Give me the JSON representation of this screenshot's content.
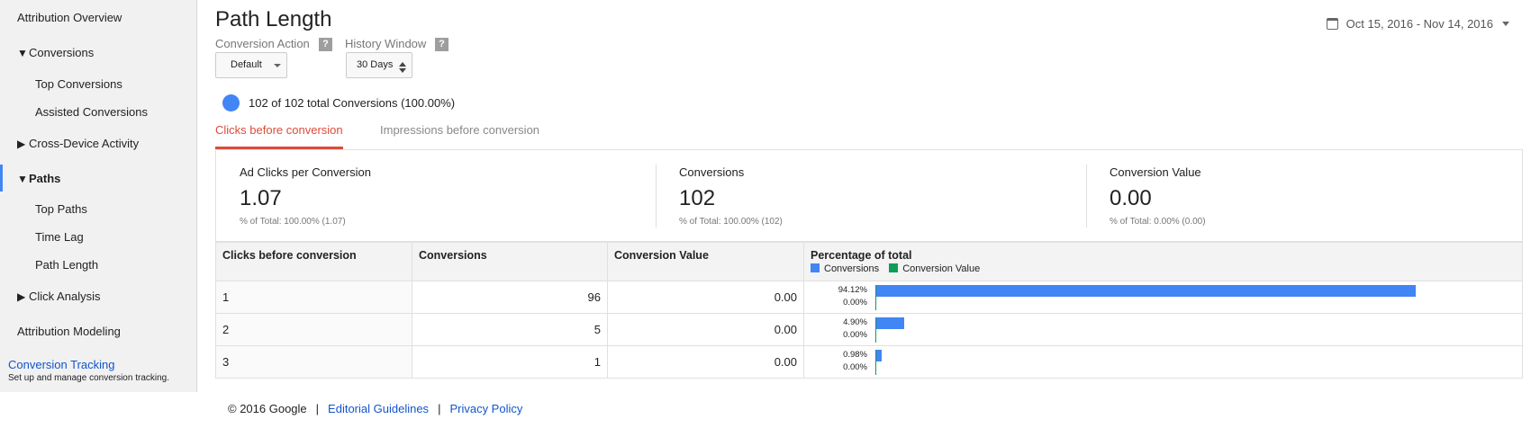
{
  "sidebar": {
    "items": [
      {
        "label": "Attribution Overview"
      },
      {
        "label": "Conversions",
        "expander": "▼"
      },
      {
        "label": "Top Conversions"
      },
      {
        "label": "Assisted Conversions"
      },
      {
        "label": "Cross-Device Activity",
        "expander": "▶"
      },
      {
        "label": "Paths",
        "expander": "▼"
      },
      {
        "label": "Top Paths"
      },
      {
        "label": "Time Lag"
      },
      {
        "label": "Path Length"
      },
      {
        "label": "Click Analysis",
        "expander": "▶"
      },
      {
        "label": "Attribution Modeling"
      }
    ],
    "footer_link": "Conversion Tracking",
    "footer_desc": "Set up and manage conversion tracking."
  },
  "header": {
    "title": "Path Length",
    "conversion_action_label": "Conversion Action",
    "conversion_action_value": "Default",
    "history_window_label": "History Window",
    "history_window_value": "30 Days",
    "help_glyph": "?",
    "date_range": "Oct 15, 2016 - Nov 14, 2016"
  },
  "summary": {
    "text": "102 of 102 total Conversions (100.00%)",
    "dot_color": "#4285f4"
  },
  "tabs": [
    {
      "label": "Clicks before conversion",
      "active": true
    },
    {
      "label": "Impressions before conversion",
      "active": false
    }
  ],
  "scorecards": [
    {
      "title": "Ad Clicks per Conversion",
      "value": "1.07",
      "sub": "% of Total: 100.00% (1.07)"
    },
    {
      "title": "Conversions",
      "value": "102",
      "sub": "% of Total: 100.00% (102)"
    },
    {
      "title": "Conversion Value",
      "value": "0.00",
      "sub": "% of Total: 0.00% (0.00)"
    }
  ],
  "table": {
    "headers": [
      "Clicks before conversion",
      "Conversions",
      "Conversion Value",
      "Percentage of total"
    ],
    "legend": [
      {
        "label": "Conversions",
        "color": "#4285f4"
      },
      {
        "label": "Conversion Value",
        "color": "#0f9d58"
      }
    ],
    "rows": [
      {
        "clicks": "1",
        "conversions": "96",
        "value": "0.00",
        "pct_conv": "94.12%",
        "pct_value": "0.00%",
        "conv_fraction": 0.9412
      },
      {
        "clicks": "2",
        "conversions": "5",
        "value": "0.00",
        "pct_conv": "4.90%",
        "pct_value": "0.00%",
        "conv_fraction": 0.049
      },
      {
        "clicks": "3",
        "conversions": "1",
        "value": "0.00",
        "pct_conv": "0.98%",
        "pct_value": "0.00%",
        "conv_fraction": 0.0098
      }
    ]
  },
  "footer": {
    "copyright": "© 2016 Google",
    "separator": "|",
    "link1": "Editorial Guidelines",
    "link2": "Privacy Policy"
  },
  "colors": {
    "accent_blue": "#4285f4",
    "active_tab_red": "#dd4b39",
    "value_green": "#0f9d58",
    "link_blue": "#1155cc"
  }
}
